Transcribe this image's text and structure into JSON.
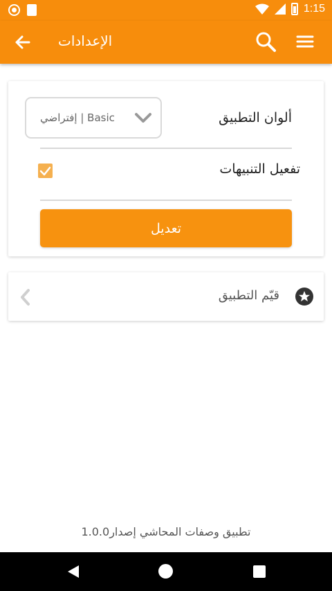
{
  "status_bar": {
    "time": "1:15",
    "icons": [
      "circle-notification-icon",
      "sd-card-icon",
      "wifi-icon",
      "signal-icon",
      "battery-icon"
    ]
  },
  "toolbar": {
    "title": "الإعدادات",
    "back_icon": "arrow-left-icon",
    "search_icon": "search-icon",
    "menu_icon": "hamburger-menu-icon"
  },
  "settings": {
    "colors_label": "ألوان التطبيق",
    "colors_value": "إفتراضي | Basic",
    "notifications_label": "تفعيل التنبيهات",
    "notifications_checked": true,
    "edit_button": "تعديل"
  },
  "rate": {
    "label": "قيّم التطبيق",
    "icon": "star-icon"
  },
  "footer": {
    "version_text": "تطبيق وصفات المحاشي إصدار1.0.0"
  },
  "colors": {
    "accent": "#f78d0c",
    "button": "#f7920f",
    "checkbox": "#f5b04f"
  }
}
